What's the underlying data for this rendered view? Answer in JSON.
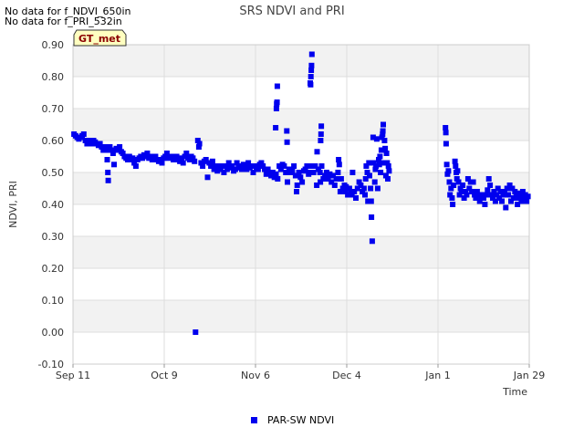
{
  "notes": [
    "No data for f_NDVI_650in",
    "No data for f_PRI_532in"
  ],
  "badge": "GT_met",
  "chart_data": {
    "type": "scatter",
    "title": "SRS NDVI and PRI",
    "xlabel": "Time",
    "ylabel": "NDVI, PRI",
    "x_tick_labels": [
      "Sep 11",
      "Oct 9",
      "Nov 6",
      "Dec 4",
      "Jan 1",
      "Jan 29"
    ],
    "x_ticks_day": [
      0,
      28,
      56,
      84,
      112,
      140
    ],
    "xlim": [
      0,
      140
    ],
    "y_ticks": [
      -0.1,
      0.0,
      0.1,
      0.2,
      0.3,
      0.4,
      0.5,
      0.6,
      0.7,
      0.8,
      0.9
    ],
    "y_tick_labels": [
      "-0.10",
      "0.00",
      "0.10",
      "0.20",
      "0.30",
      "0.40",
      "0.50",
      "0.60",
      "0.70",
      "0.80",
      "0.90"
    ],
    "ylim": [
      -0.1,
      0.9
    ],
    "grid": true,
    "legend_position": "bottom-center",
    "series": [
      {
        "name": "PAR-SW NDVI",
        "color": "#0000ee",
        "points": [
          [
            0.3,
            0.62
          ],
          [
            0.8,
            0.615
          ],
          [
            1.3,
            0.61
          ],
          [
            1.8,
            0.605
          ],
          [
            2.3,
            0.61
          ],
          [
            2.8,
            0.615
          ],
          [
            3.3,
            0.62
          ],
          [
            3.8,
            0.6
          ],
          [
            4.3,
            0.59
          ],
          [
            4.8,
            0.595
          ],
          [
            5.3,
            0.6
          ],
          [
            5.8,
            0.59
          ],
          [
            6.3,
            0.6
          ],
          [
            6.8,
            0.595
          ],
          [
            7.3,
            0.59
          ],
          [
            7.8,
            0.585
          ],
          [
            8.3,
            0.59
          ],
          [
            8.8,
            0.58
          ],
          [
            9.3,
            0.57
          ],
          [
            9.8,
            0.58
          ],
          [
            10.2,
            0.57
          ],
          [
            10.5,
            0.54
          ],
          [
            10.7,
            0.5
          ],
          [
            10.8,
            0.475
          ],
          [
            11.3,
            0.58
          ],
          [
            11.8,
            0.57
          ],
          [
            12.3,
            0.56
          ],
          [
            12.6,
            0.525
          ],
          [
            12.8,
            0.57
          ],
          [
            13.3,
            0.575
          ],
          [
            13.8,
            0.57
          ],
          [
            14.3,
            0.58
          ],
          [
            14.8,
            0.565
          ],
          [
            15.3,
            0.56
          ],
          [
            15.8,
            0.55
          ],
          [
            16.3,
            0.545
          ],
          [
            16.8,
            0.54
          ],
          [
            17.3,
            0.55
          ],
          [
            17.8,
            0.54
          ],
          [
            18.3,
            0.545
          ],
          [
            18.8,
            0.53
          ],
          [
            19.3,
            0.52
          ],
          [
            19.8,
            0.54
          ],
          [
            20.3,
            0.545
          ],
          [
            20.8,
            0.55
          ],
          [
            21.3,
            0.545
          ],
          [
            21.8,
            0.555
          ],
          [
            22.3,
            0.55
          ],
          [
            22.8,
            0.56
          ],
          [
            23.3,
            0.545
          ],
          [
            23.8,
            0.55
          ],
          [
            24.3,
            0.54
          ],
          [
            24.8,
            0.545
          ],
          [
            25.3,
            0.55
          ],
          [
            25.8,
            0.54
          ],
          [
            26.3,
            0.535
          ],
          [
            26.8,
            0.54
          ],
          [
            27.3,
            0.53
          ],
          [
            27.8,
            0.545
          ],
          [
            28.3,
            0.55
          ],
          [
            28.8,
            0.56
          ],
          [
            29.3,
            0.545
          ],
          [
            29.8,
            0.55
          ],
          [
            30.3,
            0.55
          ],
          [
            30.8,
            0.54
          ],
          [
            31.3,
            0.545
          ],
          [
            31.8,
            0.55
          ],
          [
            32.3,
            0.54
          ],
          [
            32.8,
            0.535
          ],
          [
            33.3,
            0.545
          ],
          [
            33.8,
            0.53
          ],
          [
            34.3,
            0.55
          ],
          [
            34.8,
            0.56
          ],
          [
            35.3,
            0.545
          ],
          [
            35.8,
            0.54
          ],
          [
            36.3,
            0.55
          ],
          [
            36.8,
            0.545
          ],
          [
            37.3,
            0.535
          ],
          [
            37.6,
            0.0
          ],
          [
            38.3,
            0.6
          ],
          [
            38.6,
            0.58
          ],
          [
            38.8,
            0.59
          ],
          [
            39.3,
            0.53
          ],
          [
            39.8,
            0.52
          ],
          [
            40.3,
            0.535
          ],
          [
            40.8,
            0.54
          ],
          [
            41.3,
            0.485
          ],
          [
            41.8,
            0.53
          ],
          [
            42.3,
            0.52
          ],
          [
            42.8,
            0.535
          ],
          [
            43.3,
            0.51
          ],
          [
            43.8,
            0.52
          ],
          [
            44.3,
            0.505
          ],
          [
            44.8,
            0.52
          ],
          [
            45.3,
            0.51
          ],
          [
            45.8,
            0.52
          ],
          [
            46.3,
            0.5
          ],
          [
            46.8,
            0.52
          ],
          [
            47.3,
            0.51
          ],
          [
            47.8,
            0.53
          ],
          [
            48.3,
            0.515
          ],
          [
            48.8,
            0.52
          ],
          [
            49.3,
            0.505
          ],
          [
            49.8,
            0.51
          ],
          [
            50.3,
            0.53
          ],
          [
            50.8,
            0.52
          ],
          [
            51.3,
            0.515
          ],
          [
            51.8,
            0.51
          ],
          [
            52.3,
            0.525
          ],
          [
            52.8,
            0.52
          ],
          [
            53.3,
            0.51
          ],
          [
            53.8,
            0.53
          ],
          [
            54.3,
            0.515
          ],
          [
            54.8,
            0.52
          ],
          [
            55.3,
            0.5
          ],
          [
            55.8,
            0.52
          ],
          [
            56.3,
            0.515
          ],
          [
            56.8,
            0.51
          ],
          [
            57.3,
            0.525
          ],
          [
            57.8,
            0.53
          ],
          [
            58.3,
            0.52
          ],
          [
            58.8,
            0.51
          ],
          [
            59.3,
            0.495
          ],
          [
            59.8,
            0.51
          ],
          [
            60.3,
            0.5
          ],
          [
            60.8,
            0.49
          ],
          [
            61.3,
            0.5
          ],
          [
            61.8,
            0.485
          ],
          [
            62.3,
            0.495
          ],
          [
            62.8,
            0.48
          ],
          [
            62.2,
            0.64
          ],
          [
            62.4,
            0.7
          ],
          [
            62.5,
            0.715
          ],
          [
            62.6,
            0.72
          ],
          [
            62.7,
            0.77
          ],
          [
            63.3,
            0.52
          ],
          [
            63.8,
            0.51
          ],
          [
            64.3,
            0.525
          ],
          [
            64.8,
            0.52
          ],
          [
            65.3,
            0.5
          ],
          [
            65.6,
            0.63
          ],
          [
            65.7,
            0.595
          ],
          [
            65.8,
            0.47
          ],
          [
            66.3,
            0.51
          ],
          [
            66.8,
            0.5
          ],
          [
            67.3,
            0.505
          ],
          [
            67.8,
            0.52
          ],
          [
            68.3,
            0.49
          ],
          [
            68.6,
            0.44
          ],
          [
            68.8,
            0.46
          ],
          [
            69.3,
            0.5
          ],
          [
            69.8,
            0.485
          ],
          [
            70.3,
            0.47
          ],
          [
            70.8,
            0.505
          ],
          [
            71.3,
            0.51
          ],
          [
            71.8,
            0.52
          ],
          [
            72.3,
            0.495
          ],
          [
            72.8,
            0.5
          ],
          [
            73.3,
            0.52
          ],
          [
            73.8,
            0.5
          ],
          [
            72.8,
            0.78
          ],
          [
            72.9,
            0.775
          ],
          [
            73.0,
            0.8
          ],
          [
            73.1,
            0.82
          ],
          [
            73.2,
            0.835
          ],
          [
            73.3,
            0.87
          ],
          [
            74.3,
            0.52
          ],
          [
            74.8,
            0.46
          ],
          [
            74.9,
            0.565
          ],
          [
            75.3,
            0.51
          ],
          [
            75.8,
            0.5
          ],
          [
            75.9,
            0.47
          ],
          [
            76.0,
            0.6
          ],
          [
            76.1,
            0.62
          ],
          [
            76.2,
            0.645
          ],
          [
            76.3,
            0.52
          ],
          [
            76.8,
            0.48
          ],
          [
            77.3,
            0.49
          ],
          [
            77.8,
            0.5
          ],
          [
            78.3,
            0.48
          ],
          [
            78.8,
            0.495
          ],
          [
            79.3,
            0.47
          ],
          [
            79.8,
            0.49
          ],
          [
            80.3,
            0.46
          ],
          [
            80.8,
            0.48
          ],
          [
            81.3,
            0.5
          ],
          [
            81.5,
            0.54
          ],
          [
            81.7,
            0.525
          ],
          [
            82.0,
            0.44
          ],
          [
            82.3,
            0.48
          ],
          [
            82.8,
            0.45
          ],
          [
            83.3,
            0.46
          ],
          [
            83.6,
            0.44
          ],
          [
            83.8,
            0.455
          ],
          [
            84.3,
            0.43
          ],
          [
            84.8,
            0.45
          ],
          [
            85.3,
            0.44
          ],
          [
            85.6,
            0.43
          ],
          [
            85.8,
            0.5
          ],
          [
            86.3,
            0.44
          ],
          [
            86.8,
            0.42
          ],
          [
            87.3,
            0.45
          ],
          [
            87.8,
            0.47
          ],
          [
            88.3,
            0.46
          ],
          [
            88.8,
            0.44
          ],
          [
            89.3,
            0.45
          ],
          [
            89.6,
            0.43
          ],
          [
            89.8,
            0.48
          ],
          [
            90.0,
            0.52
          ],
          [
            90.3,
            0.5
          ],
          [
            90.5,
            0.41
          ],
          [
            90.8,
            0.53
          ],
          [
            91.0,
            0.49
          ],
          [
            91.3,
            0.45
          ],
          [
            91.5,
            0.41
          ],
          [
            91.6,
            0.36
          ],
          [
            91.8,
            0.285
          ],
          [
            92.1,
            0.61
          ],
          [
            92.3,
            0.53
          ],
          [
            92.6,
            0.47
          ],
          [
            92.8,
            0.51
          ],
          [
            93.0,
            0.52
          ],
          [
            93.2,
            0.605
          ],
          [
            93.5,
            0.45
          ],
          [
            93.8,
            0.54
          ],
          [
            94.0,
            0.525
          ],
          [
            94.2,
            0.55
          ],
          [
            94.4,
            0.5
          ],
          [
            94.6,
            0.57
          ],
          [
            94.8,
            0.61
          ],
          [
            95.0,
            0.62
          ],
          [
            95.1,
            0.63
          ],
          [
            95.2,
            0.65
          ],
          [
            95.4,
            0.53
          ],
          [
            95.6,
            0.6
          ],
          [
            95.8,
            0.575
          ],
          [
            96.0,
            0.49
          ],
          [
            96.2,
            0.56
          ],
          [
            96.4,
            0.53
          ],
          [
            96.6,
            0.48
          ],
          [
            96.8,
            0.52
          ],
          [
            97.0,
            0.505
          ],
          [
            114.3,
            0.64
          ],
          [
            114.4,
            0.625
          ],
          [
            114.5,
            0.59
          ],
          [
            114.7,
            0.525
          ],
          [
            114.9,
            0.495
          ],
          [
            115.2,
            0.505
          ],
          [
            115.5,
            0.47
          ],
          [
            115.7,
            0.43
          ],
          [
            116.0,
            0.45
          ],
          [
            116.3,
            0.42
          ],
          [
            116.5,
            0.4
          ],
          [
            116.8,
            0.46
          ],
          [
            117.2,
            0.535
          ],
          [
            117.4,
            0.52
          ],
          [
            117.6,
            0.5
          ],
          [
            117.8,
            0.48
          ],
          [
            118.0,
            0.505
          ],
          [
            118.3,
            0.47
          ],
          [
            118.6,
            0.43
          ],
          [
            118.9,
            0.45
          ],
          [
            119.2,
            0.44
          ],
          [
            119.6,
            0.46
          ],
          [
            120.0,
            0.42
          ],
          [
            120.4,
            0.44
          ],
          [
            120.8,
            0.43
          ],
          [
            121.2,
            0.48
          ],
          [
            121.6,
            0.45
          ],
          [
            122.0,
            0.47
          ],
          [
            122.4,
            0.44
          ],
          [
            122.8,
            0.47
          ],
          [
            123.2,
            0.43
          ],
          [
            123.6,
            0.42
          ],
          [
            124.0,
            0.44
          ],
          [
            124.4,
            0.43
          ],
          [
            124.8,
            0.41
          ],
          [
            125.2,
            0.425
          ],
          [
            125.6,
            0.43
          ],
          [
            126.0,
            0.42
          ],
          [
            126.4,
            0.4
          ],
          [
            126.8,
            0.43
          ],
          [
            127.2,
            0.445
          ],
          [
            127.6,
            0.48
          ],
          [
            128.0,
            0.46
          ],
          [
            128.4,
            0.43
          ],
          [
            128.8,
            0.42
          ],
          [
            129.2,
            0.44
          ],
          [
            129.6,
            0.41
          ],
          [
            130.0,
            0.43
          ],
          [
            130.4,
            0.45
          ],
          [
            130.8,
            0.42
          ],
          [
            131.2,
            0.44
          ],
          [
            131.6,
            0.41
          ],
          [
            132.0,
            0.43
          ],
          [
            132.4,
            0.44
          ],
          [
            132.8,
            0.39
          ],
          [
            133.2,
            0.45
          ],
          [
            133.6,
            0.43
          ],
          [
            134.0,
            0.46
          ],
          [
            134.4,
            0.41
          ],
          [
            134.8,
            0.45
          ],
          [
            135.2,
            0.42
          ],
          [
            135.6,
            0.44
          ],
          [
            136.0,
            0.43
          ],
          [
            136.4,
            0.4
          ],
          [
            136.8,
            0.42
          ],
          [
            137.2,
            0.435
          ],
          [
            137.6,
            0.41
          ],
          [
            138.0,
            0.44
          ],
          [
            138.4,
            0.42
          ],
          [
            138.8,
            0.43
          ],
          [
            139.2,
            0.41
          ],
          [
            139.6,
            0.425
          ]
        ]
      }
    ]
  }
}
